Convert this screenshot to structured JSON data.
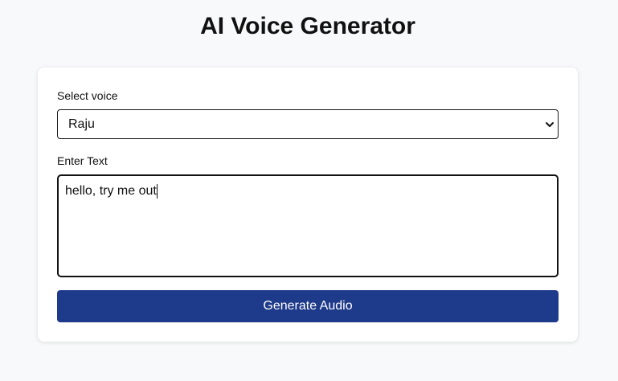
{
  "page": {
    "title": "AI Voice Generator"
  },
  "form": {
    "voice_label": "Select voice",
    "voice_selected": "Raju",
    "text_label": "Enter Text",
    "text_value": "hello, try me out",
    "generate_label": "Generate Audio"
  },
  "icons": {
    "select_chevron": "chevron-down-icon"
  },
  "colors": {
    "page_background": "#f8f9fb",
    "card_background": "#ffffff",
    "button_background": "#1e3a8a",
    "button_text": "#ffffff"
  }
}
